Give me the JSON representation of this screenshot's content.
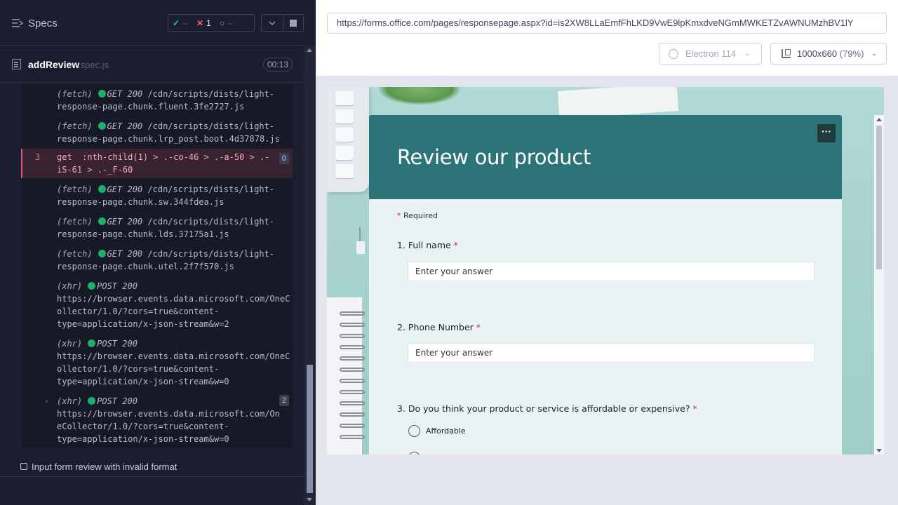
{
  "reporter": {
    "header": {
      "title": "Specs"
    },
    "stats": {
      "passed": "--",
      "failed": "1",
      "pending": "--"
    },
    "spec": {
      "name": "addReview",
      "ext": ".spec.js",
      "duration": "00:13"
    },
    "log": [
      {
        "kind": "(fetch)",
        "method": "GET 200",
        "text": "/cdn/scripts/dists/light-\nresponse-page.chunk.fluent.3fe2727.js"
      },
      {
        "kind": "(fetch)",
        "method": "GET 200",
        "text": "/cdn/scripts/dists/light-\nresponse-page.chunk.lrp_post.boot.4d37878.js"
      },
      {
        "num": "3",
        "text": "get  :nth-child(1) > .-co-46 > .-a-50 > .-\niS-61 > .-_F-60",
        "badge": "0"
      },
      {
        "kind": "(fetch)",
        "method": "GET 200",
        "text": "/cdn/scripts/dists/light-\nresponse-page.chunk.sw.344fdea.js"
      },
      {
        "kind": "(fetch)",
        "method": "GET 200",
        "text": "/cdn/scripts/dists/light-\nresponse-page.chunk.lds.37175a1.js"
      },
      {
        "kind": "(fetch)",
        "method": "GET 200",
        "text": "/cdn/scripts/dists/light-\nresponse-page.chunk.utel.2f7f570.js"
      },
      {
        "kind": "(xhr)",
        "method": "POST 200",
        "text": "https://browser.events.data.microsoft.com/OneC\nollector/1.0/?cors=true&content-\ntype=application/x-json-stream&w=2"
      },
      {
        "kind": "(xhr)",
        "method": "POST 200",
        "text": "https://browser.events.data.microsoft.com/OneC\nollector/1.0/?cors=true&content-\ntype=application/x-json-stream&w=0"
      },
      {
        "kind": "(xhr)",
        "method": "POST 200",
        "text": "https://browser.events.data.microsoft.com/On\neCollector/1.0/?cors=true&content-\ntype=application/x-json-stream&w=0",
        "badge": "2"
      }
    ],
    "test_title": "Input form review with invalid format"
  },
  "aut": {
    "url": "https://forms.office.com/pages/responsepage.aspx?id=is2XW8LLaEmfFhLKD9VwE9lpKmxdveNGmMWKETZvAWNUMzhBV1lY",
    "browser": "Electron 114",
    "viewport": "1000x660",
    "zoom": "(79%)"
  },
  "form": {
    "title": "Review our product",
    "more": "···",
    "required_note": "Required",
    "questions": [
      {
        "label": "1. Full name",
        "placeholder": "Enter your answer"
      },
      {
        "label": "2. Phone Number",
        "placeholder": "Enter your answer"
      },
      {
        "label": "3. Do you think your product or service is affordable or expensive?",
        "options": [
          "Affordable"
        ]
      }
    ]
  },
  "colors": {
    "form_header": "#2d7479",
    "fail": "#ff5a70",
    "pass": "#25c59b"
  }
}
